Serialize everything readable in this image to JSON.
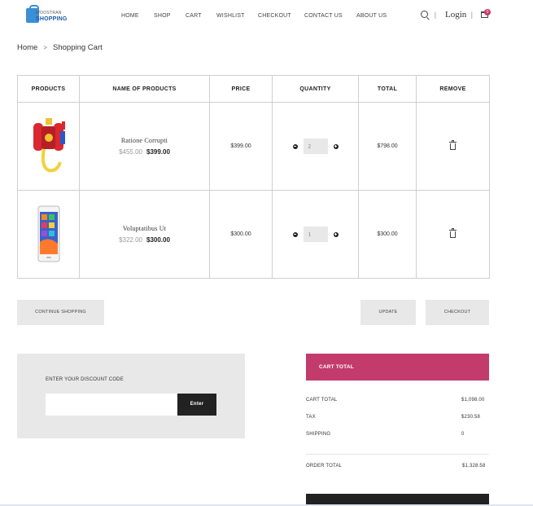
{
  "brand": {
    "line1": "WOOSTRAN",
    "line2": "SHOPPING"
  },
  "nav": [
    "Home",
    "Shop",
    "Cart",
    "Wishlist",
    "Checkout",
    "Contact us",
    "About us"
  ],
  "header": {
    "login": "Login",
    "separator": "|",
    "cart_count": "0"
  },
  "breadcrumb": {
    "home": "Home",
    "sep": ">",
    "current": "Shopping Cart"
  },
  "table": {
    "headers": [
      "PRODUCTS",
      "NAME OF PRODUCTS",
      "PRICE",
      "QUANTITY",
      "TOTAL",
      "REMOVE"
    ],
    "rows": [
      {
        "name": "Ratione Corrupti",
        "old_price": "$455.00",
        "new_price": "$399.00",
        "price": "$399.00",
        "quantity": "2",
        "total": "$798.00",
        "image": "water-gun-backpack"
      },
      {
        "name": "Voluptatibus Ut",
        "old_price": "$322.00",
        "new_price": "$300.00",
        "price": "$300.00",
        "quantity": "1",
        "total": "$300.00",
        "image": "smartphone"
      }
    ]
  },
  "buttons": {
    "continue": "Continue Shopping",
    "update": "Update",
    "checkout": "Checkout"
  },
  "discount": {
    "label": "Enter your discount code",
    "value": "",
    "submit": "Enter"
  },
  "cart_totals": {
    "title": "Cart Total",
    "rows": [
      {
        "label": "Cart Total",
        "value": "$1,098.00"
      },
      {
        "label": "Tax",
        "value": "$230.58"
      },
      {
        "label": "Shipping",
        "value": "0"
      }
    ],
    "order_total_label": "Order Total",
    "order_total_value": "$1,328.58"
  },
  "colors": {
    "accent": "#c33b6a",
    "dark": "#222222",
    "panel": "#e8e8e8"
  }
}
